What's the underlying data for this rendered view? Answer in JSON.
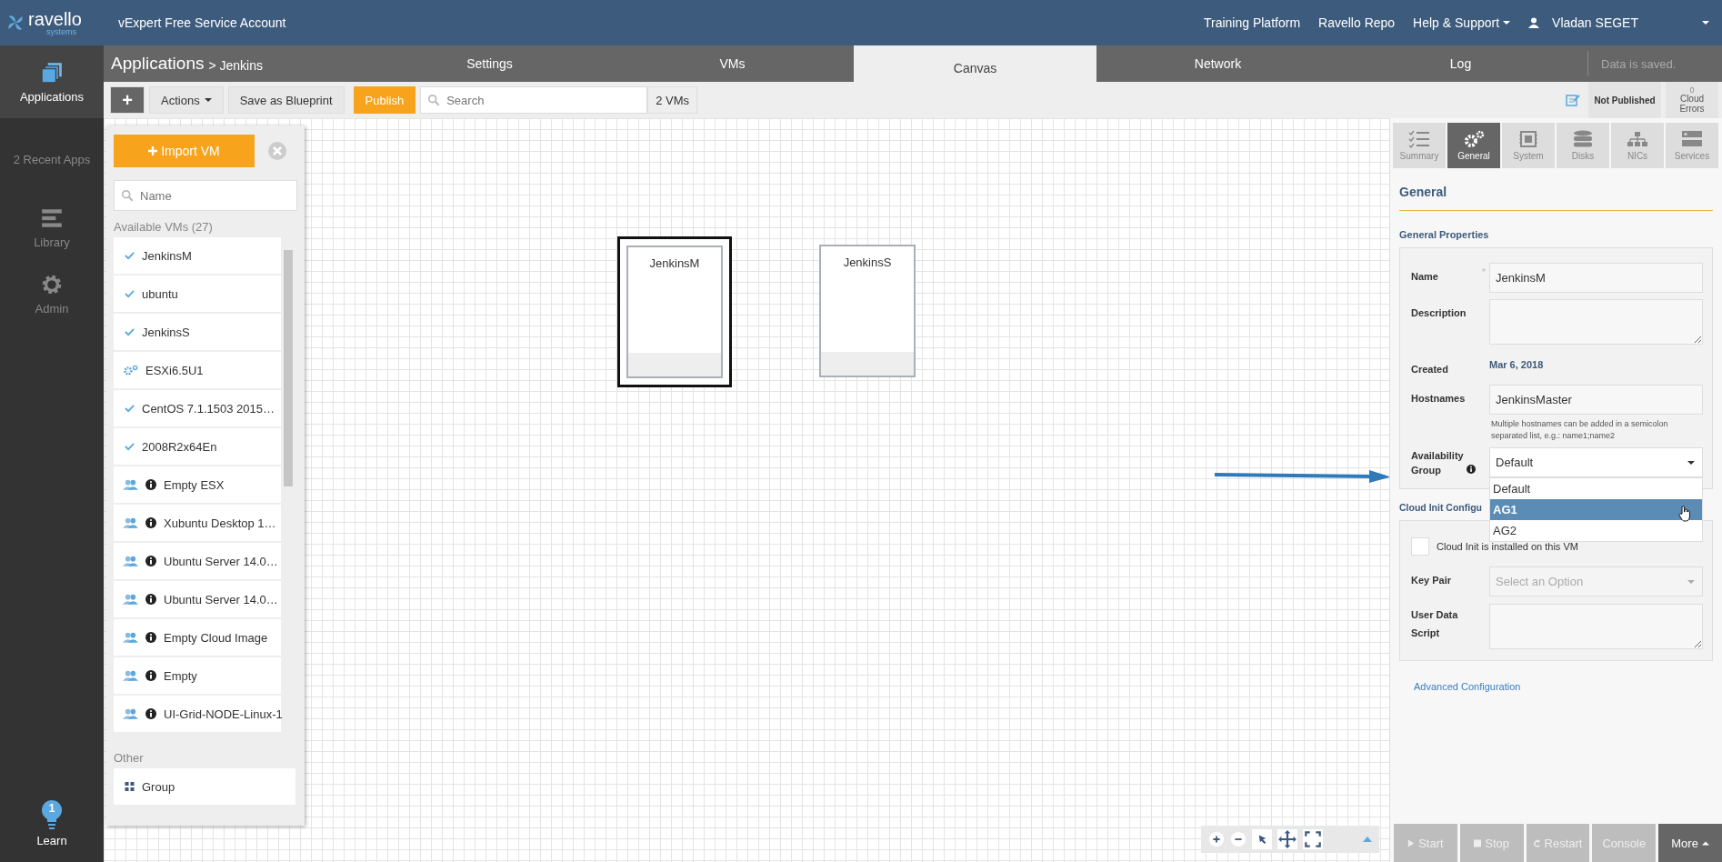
{
  "header": {
    "brand": "ravello",
    "tagline": "systems",
    "account": "vExpert Free Service Account",
    "links": [
      {
        "label": "Training Platform",
        "dropdown": false
      },
      {
        "label": "Ravello Repo",
        "dropdown": false
      },
      {
        "label": "Help & Support",
        "dropdown": true
      }
    ],
    "user": {
      "name": "Vladan SEGET",
      "dropdown": true
    }
  },
  "nav": {
    "items": [
      {
        "label": "Applications",
        "kind": "apps",
        "selected": true
      },
      {
        "label": "2 Recent Apps",
        "kind": "text",
        "selected": false
      },
      {
        "label": "Library",
        "kind": "library",
        "selected": false
      },
      {
        "label": "Admin",
        "kind": "admin",
        "selected": false
      }
    ],
    "learn": {
      "label": "Learn",
      "badge": "1"
    }
  },
  "breadcrumb": {
    "root": "Applications",
    "current": "> Jenkins"
  },
  "tabs": [
    {
      "label": "Settings",
      "selected": false
    },
    {
      "label": "VMs",
      "selected": false
    },
    {
      "label": "Canvas",
      "selected": true
    },
    {
      "label": "Network",
      "selected": false
    },
    {
      "label": "Log",
      "selected": false
    }
  ],
  "save_status": "Data is saved.",
  "toolbar": {
    "add": "+",
    "actions": "Actions",
    "blueprint": "Save as Blueprint",
    "publish": "Publish",
    "search_placeholder": "Search",
    "vm_count": "2 VMs",
    "publish_status": "Not Published",
    "cloud_errors": {
      "count": "0",
      "label": "Cloud Errors"
    }
  },
  "library": {
    "import": "Import VM",
    "name_placeholder": "Name",
    "available_title": "Available VMs (27)",
    "vms": [
      {
        "name": "JenkinsM",
        "kind": "check"
      },
      {
        "name": "ubuntu",
        "kind": "check"
      },
      {
        "name": "JenkinsS",
        "kind": "check"
      },
      {
        "name": "ESXi6.5U1",
        "kind": "gear"
      },
      {
        "name": "CentOS 7.1.1503 2015…",
        "kind": "check"
      },
      {
        "name": "2008R2x64En",
        "kind": "check"
      },
      {
        "name": "Empty ESX",
        "kind": "shared"
      },
      {
        "name": "Xubuntu Desktop 1…",
        "kind": "shared"
      },
      {
        "name": "Ubuntu Server 14.0…",
        "kind": "shared"
      },
      {
        "name": "Ubuntu Server 14.0…",
        "kind": "shared"
      },
      {
        "name": "Empty Cloud Image",
        "kind": "shared"
      },
      {
        "name": "Empty",
        "kind": "shared"
      },
      {
        "name": "UI-Grid-NODE-Linux-1",
        "kind": "shared"
      }
    ],
    "other_title": "Other",
    "other": [
      {
        "name": "Group"
      }
    ]
  },
  "canvas": {
    "nodes": [
      {
        "name": "JenkinsM",
        "selected": true
      },
      {
        "name": "JenkinsS",
        "selected": false
      }
    ]
  },
  "panel": {
    "tabs": [
      {
        "label": "Summary",
        "selected": false
      },
      {
        "label": "General",
        "selected": true
      },
      {
        "label": "System",
        "selected": false
      },
      {
        "label": "Disks",
        "selected": false
      },
      {
        "label": "NICs",
        "selected": false
      },
      {
        "label": "Services",
        "selected": false
      }
    ],
    "heading": "General",
    "section": "General Properties",
    "name": {
      "label": "Name",
      "required": "*",
      "value": "JenkinsM"
    },
    "description": {
      "label": "Description"
    },
    "created": {
      "label": "Created",
      "value": "Mar 6, 2018"
    },
    "hostnames": {
      "label": "Hostnames",
      "value": "JenkinsMaster",
      "help": "Multiple hostnames can be added in a semicolon separated list, e.g.: name1;name2"
    },
    "availability": {
      "label": "Availability Group",
      "value": "Default",
      "options": [
        {
          "label": "Default",
          "highlighted": false
        },
        {
          "label": "AG1",
          "highlighted": true
        },
        {
          "label": "AG2",
          "highlighted": false
        }
      ]
    },
    "cloud_init": {
      "title": "Cloud Init Configu",
      "checkbox": {
        "label": "Cloud Init is installed on this VM",
        "checked": false
      },
      "key_pair": {
        "label": "Key Pair",
        "placeholder": "Select an Option"
      },
      "user_data": {
        "label_1": "User Data",
        "label_2": "Script"
      }
    },
    "advanced": "Advanced Configuration",
    "actions": [
      {
        "label": "Start",
        "disabled": true
      },
      {
        "label": "Stop",
        "disabled": true
      },
      {
        "label": "Restart",
        "disabled": true
      },
      {
        "label": "Console",
        "disabled": true
      },
      {
        "label": "More",
        "disabled": false
      }
    ]
  }
}
